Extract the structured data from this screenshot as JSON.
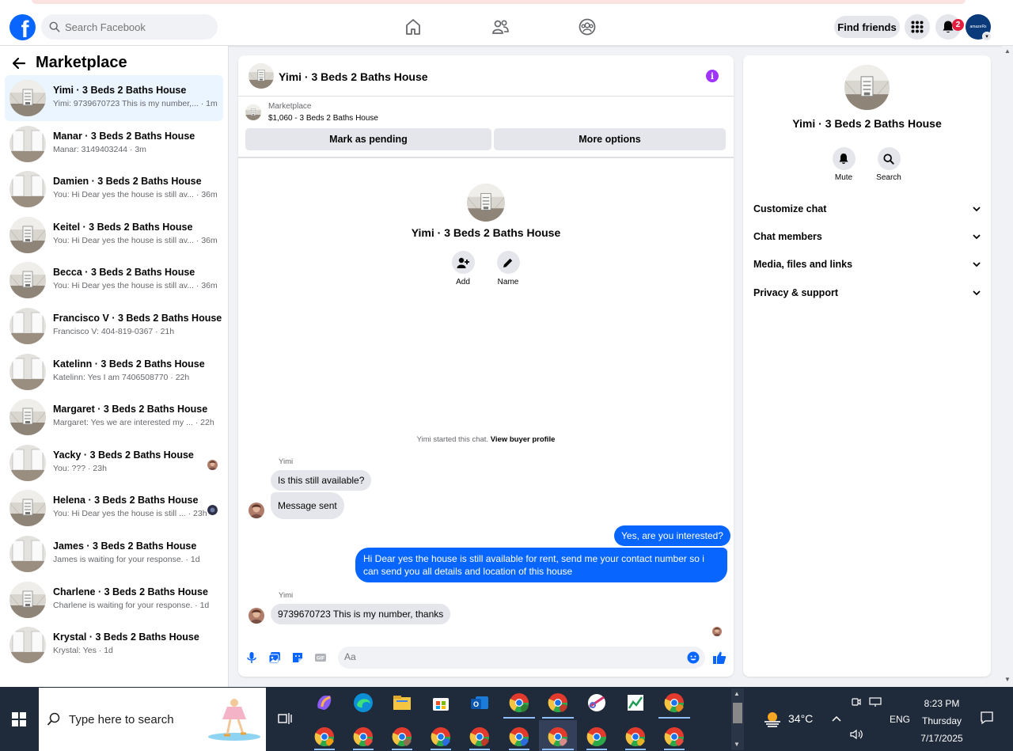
{
  "header": {
    "search_placeholder": "Search Facebook",
    "find_friends_label": "Find friends",
    "notification_count": "2",
    "profile_text": "amazeRx",
    "brand_color": "#0866ff"
  },
  "sidebar": {
    "title": "Marketplace",
    "conversations": [
      {
        "title": "Yimi · 3 Beds 2 Baths House",
        "preview": "Yimi: 9739670723 This is my number,... · 1m",
        "active": true
      },
      {
        "title": "Manar · 3 Beds 2 Baths House",
        "preview": "Manar: 3149403244 · 3m"
      },
      {
        "title": "Damien · 3 Beds 2 Baths House",
        "preview": "You: Hi Dear yes the house is still av... · 36m"
      },
      {
        "title": "Keitel · 3 Beds 2 Baths House",
        "preview": "You: Hi Dear yes the house is still av... · 36m"
      },
      {
        "title": "Becca · 3 Beds 2 Baths House",
        "preview": "You: Hi Dear yes the house is still av... · 36m"
      },
      {
        "title": "Francisco V · 3 Beds 2 Baths House",
        "preview": "Francisco V: 404-819-0367 · 21h"
      },
      {
        "title": "Katelinn · 3 Beds 2 Baths House",
        "preview": "Katelinn: Yes I am 7406508770 · 22h"
      },
      {
        "title": "Margaret · 3 Beds 2 Baths House",
        "preview": "Margaret: Yes we are interested my ... · 22h"
      },
      {
        "title": "Yacky · 3 Beds 2 Baths House",
        "preview": "You: ??? · 23h"
      },
      {
        "title": "Helena · 3 Beds 2 Baths House",
        "preview": "You: Hi Dear yes the house is still ... · 23h"
      },
      {
        "title": "James · 3 Beds 2 Baths House",
        "preview": "James is waiting for your response. · 1d"
      },
      {
        "title": "Charlene · 3 Beds 2 Baths House",
        "preview": "Charlene is waiting for your response. · 1d"
      },
      {
        "title": "Krystal · 3 Beds 2 Baths House",
        "preview": "Krystal: Yes · 1d"
      }
    ]
  },
  "chat": {
    "title": "Yimi · 3 Beds 2 Baths House",
    "listing_source": "Marketplace",
    "listing_price": "$1,060 - 3 Beds 2 Baths House",
    "mark_pending_label": "Mark as pending",
    "more_options_label": "More options",
    "intro_name": "Yimi · 3 Beds 2 Baths House",
    "add_label": "Add",
    "name_label": "Name",
    "started_text": "Yimi started this chat.",
    "view_profile_label": "View buyer profile",
    "sender_name": "Yimi",
    "messages": [
      {
        "text": "Is this still available?"
      },
      {
        "text": "Message sent"
      },
      {
        "text": "Yes, are you interested?"
      },
      {
        "text": "Hi Dear yes the house is still available for rent, send me your contact number so i can send you all details and location of this house"
      },
      {
        "text": "9739670723 This is my number, thanks"
      }
    ],
    "composer_placeholder": "Aa"
  },
  "right_panel": {
    "name": "Yimi · 3 Beds 2 Baths House",
    "mute_label": "Mute",
    "search_label": "Search",
    "sections": [
      "Customize chat",
      "Chat members",
      "Media, files and links",
      "Privacy & support"
    ]
  },
  "taskbar": {
    "search_placeholder": "Type here to search",
    "temperature": "34°C",
    "language": "ENG",
    "time": "8:23 PM",
    "day": "Thursday",
    "date": "7/17/2025"
  }
}
